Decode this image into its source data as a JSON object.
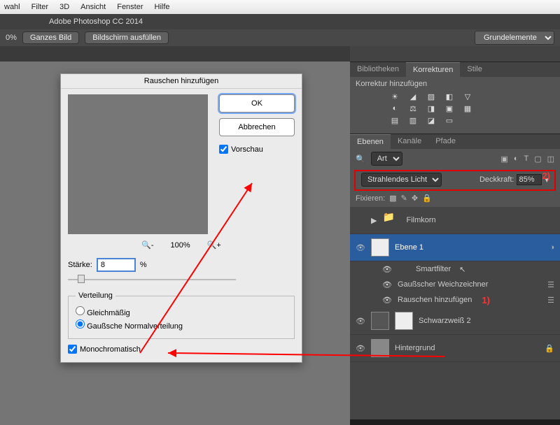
{
  "os_menu": [
    "wahl",
    "Filter",
    "3D",
    "Ansicht",
    "Fenster",
    "Hilfe"
  ],
  "app_title": "Adobe Photoshop CC 2014",
  "opt_bar": {
    "zoom": "0%",
    "btn1": "Ganzes Bild",
    "btn2": "Bildschirm ausfüllen",
    "workspace": "Grundelemente"
  },
  "panel_tabs1": {
    "t1": "Bibliotheken",
    "t2": "Korrekturen",
    "t3": "Stile"
  },
  "korrektur_label": "Korrektur hinzufügen",
  "panel_tabs2": {
    "t1": "Ebenen",
    "t2": "Kanäle",
    "t3": "Pfade"
  },
  "layers_top_select": "Art",
  "blend_mode": "Strahlendes Licht",
  "opacity_label": "Deckkraft:",
  "opacity_value": "85%",
  "fix_label": "Fixieren:",
  "layers": {
    "filmkorn": "Filmkorn",
    "ebene1": "Ebene 1",
    "smartfilter": "Smartfilter",
    "gauss_blur": "Gaußscher Weichzeichner",
    "add_noise": "Rauschen hinzufügen",
    "schwarz": "Schwarzweiß 2",
    "hintergrund": "Hintergrund"
  },
  "dialog": {
    "title": "Rauschen hinzufügen",
    "ok": "OK",
    "cancel": "Abbrechen",
    "preview": "Vorschau",
    "zoom": "100%",
    "strength_label": "Stärke:",
    "strength_value": "8",
    "percent": "%",
    "dist_legend": "Verteilung",
    "dist_uniform": "Gleichmäßig",
    "dist_gauss": "Gaußsche Normalverteilung",
    "mono": "Monochromatisch"
  },
  "annot": {
    "n1": "1)",
    "n2": "2)"
  }
}
